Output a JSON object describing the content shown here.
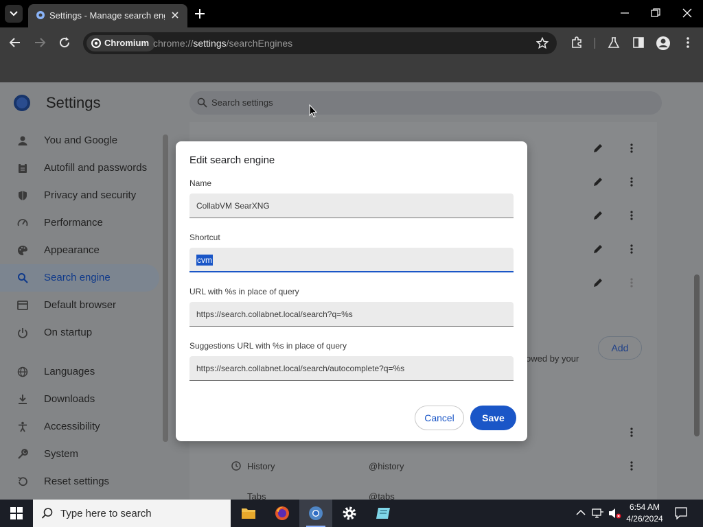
{
  "browser": {
    "tab_title": "Settings - Manage search engines",
    "omnibox_chip": "Chromium",
    "url_prefix": "chrome://",
    "url_host": "settings",
    "url_path": "/searchEngines"
  },
  "settings": {
    "title": "Settings",
    "search_placeholder": "Search settings",
    "nav": [
      {
        "label": "You and Google",
        "icon": "person-icon"
      },
      {
        "label": "Autofill and passwords",
        "icon": "clipboard-icon"
      },
      {
        "label": "Privacy and security",
        "icon": "shield-icon"
      },
      {
        "label": "Performance",
        "icon": "speedometer-icon"
      },
      {
        "label": "Appearance",
        "icon": "palette-icon"
      },
      {
        "label": "Search engine",
        "icon": "search-icon",
        "active": true
      },
      {
        "label": "Default browser",
        "icon": "browser-window-icon"
      },
      {
        "label": "On startup",
        "icon": "power-icon"
      },
      {
        "label": "Languages",
        "icon": "globe-icon"
      },
      {
        "label": "Downloads",
        "icon": "download-icon"
      },
      {
        "label": "Accessibility",
        "icon": "accessibility-icon"
      },
      {
        "label": "System",
        "icon": "wrench-icon"
      },
      {
        "label": "Reset settings",
        "icon": "reset-icon"
      }
    ],
    "content": {
      "partial_text": "owed by your",
      "add_label": "Add",
      "history_name": "History",
      "history_shortcut": "@history",
      "tabs_name": "Tabs",
      "tabs_shortcut": "@tabs"
    }
  },
  "dialog": {
    "title": "Edit search engine",
    "name_label": "Name",
    "name_value": "CollabVM SearXNG",
    "shortcut_label": "Shortcut",
    "shortcut_value": "cvm",
    "url_label": "URL with %s in place of query",
    "url_value": "https://search.collabnet.local/search?q=%s",
    "suggest_label": "Suggestions URL with %s in place of query",
    "suggest_value": "https://search.collabnet.local/search/autocomplete?q=%s",
    "cancel_label": "Cancel",
    "save_label": "Save"
  },
  "taskbar": {
    "search_placeholder": "Type here to search",
    "time": "6:54 AM",
    "date": "4/26/2024"
  },
  "colors": {
    "accent": "#1a56c7",
    "chrome_dark": "#3c3c3c",
    "taskbar": "#1b1e26"
  }
}
